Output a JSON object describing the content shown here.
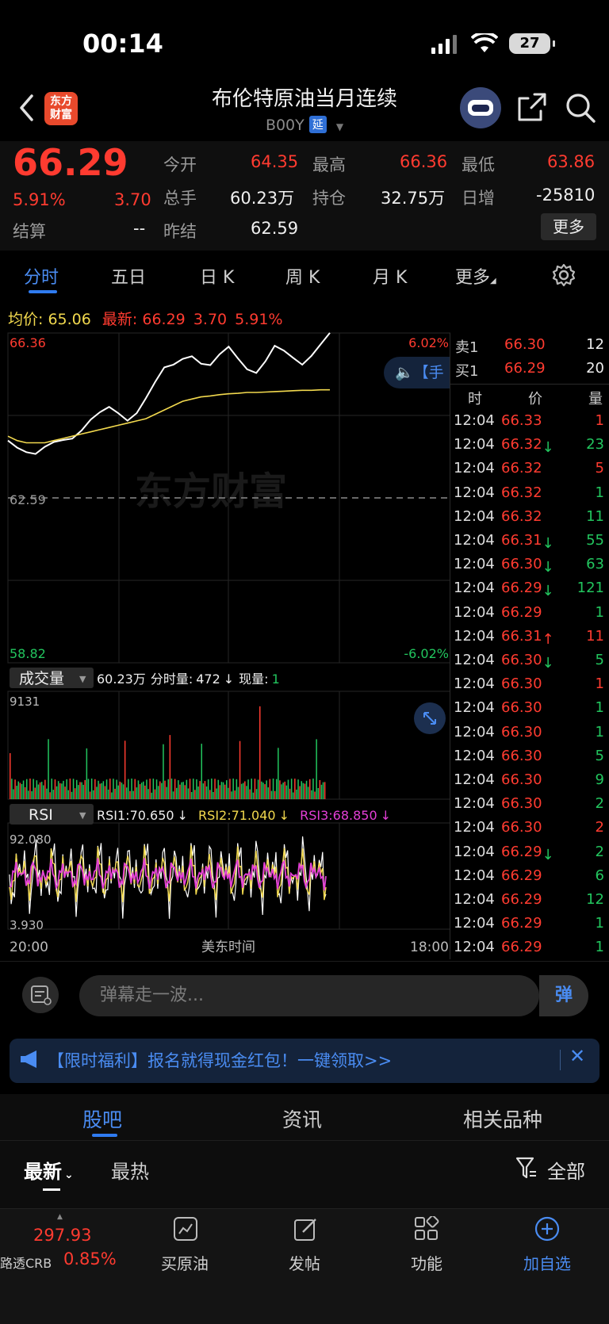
{
  "status": {
    "time": "00:14",
    "battery": "27"
  },
  "header": {
    "logo_text": "东方\n财富",
    "title": "布伦特原油当月连续",
    "code": "B00Y",
    "code_tag": "延"
  },
  "quote": {
    "price": "66.29",
    "change_pct": "5.91%",
    "change": "3.70",
    "settle_label": "结算",
    "settle_value": "--",
    "open_label": "今开",
    "open_value": "64.35",
    "volume_label": "总手",
    "volume_value": "60.23万",
    "prev_settle_label": "昨结",
    "prev_settle_value": "62.59",
    "high_label": "最高",
    "high_value": "66.36",
    "oi_label": "持仓",
    "oi_value": "32.75万",
    "low_label": "最低",
    "low_value": "63.86",
    "daily_inc_label": "日增",
    "daily_inc_value": "-25810",
    "more_label": "更多"
  },
  "tabs": [
    "分时",
    "五日",
    "日 K",
    "周 K",
    "月 K",
    "更多"
  ],
  "chart_info": {
    "avg_label": "均价:",
    "avg_value": "65.06",
    "latest_label": "最新:",
    "latest_value": "66.29",
    "latest_change": "3.70",
    "latest_pct": "5.91%"
  },
  "chart_data": {
    "type": "line",
    "price_axis": {
      "top": "66.36",
      "mid": "62.59",
      "bottom": "58.82",
      "top_pct": "6.02%",
      "bottom_pct": "-6.02%"
    },
    "x_axis": {
      "start": "20:00",
      "mid": "美东时间",
      "end": "18:00"
    },
    "watermark": "东方财富",
    "series": [
      {
        "name": "最新",
        "color": "#ffffff",
        "values": [
          63.9,
          63.8,
          63.7,
          63.6,
          63.7,
          63.8,
          63.9,
          64.0,
          64.2,
          64.4,
          64.5,
          64.6,
          64.5,
          64.4,
          64.6,
          64.9,
          65.2,
          65.5,
          65.6,
          65.8,
          65.9,
          65.7,
          65.6,
          65.8,
          66.0,
          65.8,
          65.6,
          65.5,
          65.7,
          66.0,
          65.9,
          65.8,
          65.7,
          65.9,
          66.1,
          66.3
        ]
      },
      {
        "name": "均价",
        "color": "#f2d94e",
        "values": [
          64.0,
          63.9,
          63.85,
          63.85,
          63.85,
          63.9,
          63.95,
          64.0,
          64.05,
          64.1,
          64.15,
          64.2,
          64.25,
          64.3,
          64.35,
          64.4,
          64.5,
          64.6,
          64.7,
          64.8,
          64.85,
          64.9,
          64.92,
          64.95,
          64.97,
          64.98,
          65.0,
          65.0,
          65.01,
          65.02,
          65.03,
          65.04,
          65.05,
          65.05,
          65.06,
          65.06
        ]
      }
    ],
    "ylim": [
      58.82,
      66.36
    ],
    "volume": {
      "label": "成交量",
      "total": "60.23万",
      "minute_label": "分时量:",
      "minute_value": "472",
      "now_label": "现量:",
      "now_value": "1",
      "max_label": "9131"
    },
    "rsi": {
      "label": "RSI",
      "rsi1": "RSI1:70.650",
      "rsi2": "RSI2:71.040",
      "rsi3": "RSI3:68.850",
      "top_label": "92.080",
      "bottom_label": "3.930"
    }
  },
  "tooltip_text": "【手",
  "order_book": {
    "ask": {
      "label": "卖1",
      "price": "66.30",
      "qty": "12"
    },
    "bid": {
      "label": "买1",
      "price": "66.29",
      "qty": "20"
    },
    "headers": [
      "时",
      "价",
      "量"
    ],
    "ticks": [
      {
        "time": "12:04",
        "price": "66.33",
        "dir": "",
        "qty": "1",
        "qc": "red"
      },
      {
        "time": "12:04",
        "price": "66.32",
        "dir": "↓",
        "qty": "23",
        "qc": "green"
      },
      {
        "time": "12:04",
        "price": "66.32",
        "dir": "",
        "qty": "5",
        "qc": "red"
      },
      {
        "time": "12:04",
        "price": "66.32",
        "dir": "",
        "qty": "1",
        "qc": "green"
      },
      {
        "time": "12:04",
        "price": "66.32",
        "dir": "",
        "qty": "11",
        "qc": "green"
      },
      {
        "time": "12:04",
        "price": "66.31",
        "dir": "↓",
        "qty": "55",
        "qc": "green"
      },
      {
        "time": "12:04",
        "price": "66.30",
        "dir": "↓",
        "qty": "63",
        "qc": "green"
      },
      {
        "time": "12:04",
        "price": "66.29",
        "dir": "↓",
        "qty": "121",
        "qc": "green"
      },
      {
        "time": "12:04",
        "price": "66.29",
        "dir": "",
        "qty": "1",
        "qc": "green"
      },
      {
        "time": "12:04",
        "price": "66.31",
        "dir": "↑",
        "qty": "11",
        "qc": "red"
      },
      {
        "time": "12:04",
        "price": "66.30",
        "dir": "↓",
        "qty": "5",
        "qc": "green"
      },
      {
        "time": "12:04",
        "price": "66.30",
        "dir": "",
        "qty": "1",
        "qc": "red"
      },
      {
        "time": "12:04",
        "price": "66.30",
        "dir": "",
        "qty": "1",
        "qc": "green"
      },
      {
        "time": "12:04",
        "price": "66.30",
        "dir": "",
        "qty": "1",
        "qc": "green"
      },
      {
        "time": "12:04",
        "price": "66.30",
        "dir": "",
        "qty": "5",
        "qc": "green"
      },
      {
        "time": "12:04",
        "price": "66.30",
        "dir": "",
        "qty": "9",
        "qc": "green"
      },
      {
        "time": "12:04",
        "price": "66.30",
        "dir": "",
        "qty": "2",
        "qc": "green"
      },
      {
        "time": "12:04",
        "price": "66.30",
        "dir": "",
        "qty": "2",
        "qc": "red"
      },
      {
        "time": "12:04",
        "price": "66.29",
        "dir": "↓",
        "qty": "2",
        "qc": "green"
      },
      {
        "time": "12:04",
        "price": "66.29",
        "dir": "",
        "qty": "6",
        "qc": "green"
      },
      {
        "time": "12:04",
        "price": "66.29",
        "dir": "",
        "qty": "12",
        "qc": "green"
      },
      {
        "time": "12:04",
        "price": "66.29",
        "dir": "",
        "qty": "1",
        "qc": "green"
      },
      {
        "time": "12:04",
        "price": "66.29",
        "dir": "",
        "qty": "1",
        "qc": "green"
      }
    ]
  },
  "danmu": {
    "placeholder": "弹幕走一波...",
    "send": "弹"
  },
  "banner": {
    "text": "【限时福利】报名就得现金红包！一键领取>>"
  },
  "sections": {
    "tabs": [
      "股吧",
      "资讯",
      "相关品种"
    ],
    "filters": {
      "latest": "最新",
      "hot": "最热",
      "all": "全部"
    }
  },
  "navbar": {
    "index_value": "297.93",
    "index_name": "路透CRB",
    "index_pct": "0.85%",
    "items": [
      "买原油",
      "发帖",
      "功能",
      "加自选"
    ]
  }
}
